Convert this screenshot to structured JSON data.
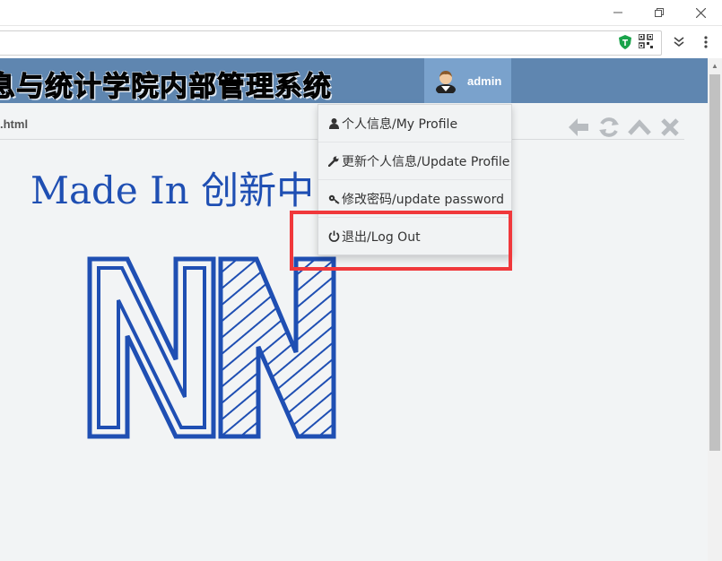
{
  "header": {
    "title": "息与统计学院内部管理系统",
    "username": "admin"
  },
  "breadcrumb": ".html",
  "content": {
    "made_in": "Made In 创新中"
  },
  "dropdown": {
    "items": [
      {
        "label": "个人信息/My Profile",
        "icon": "user-icon"
      },
      {
        "label": "更新个人信息/Update Profile",
        "icon": "wrench-icon"
      },
      {
        "label": "修改密码/update password",
        "icon": "key-icon"
      },
      {
        "label": "退出/Log Out",
        "icon": "power-icon"
      }
    ]
  },
  "colors": {
    "header_bg": "#5f86b0",
    "user_box_bg": "#7aa2cc",
    "highlight": "#f0383b",
    "logo_blue": "#1f4fb3"
  }
}
